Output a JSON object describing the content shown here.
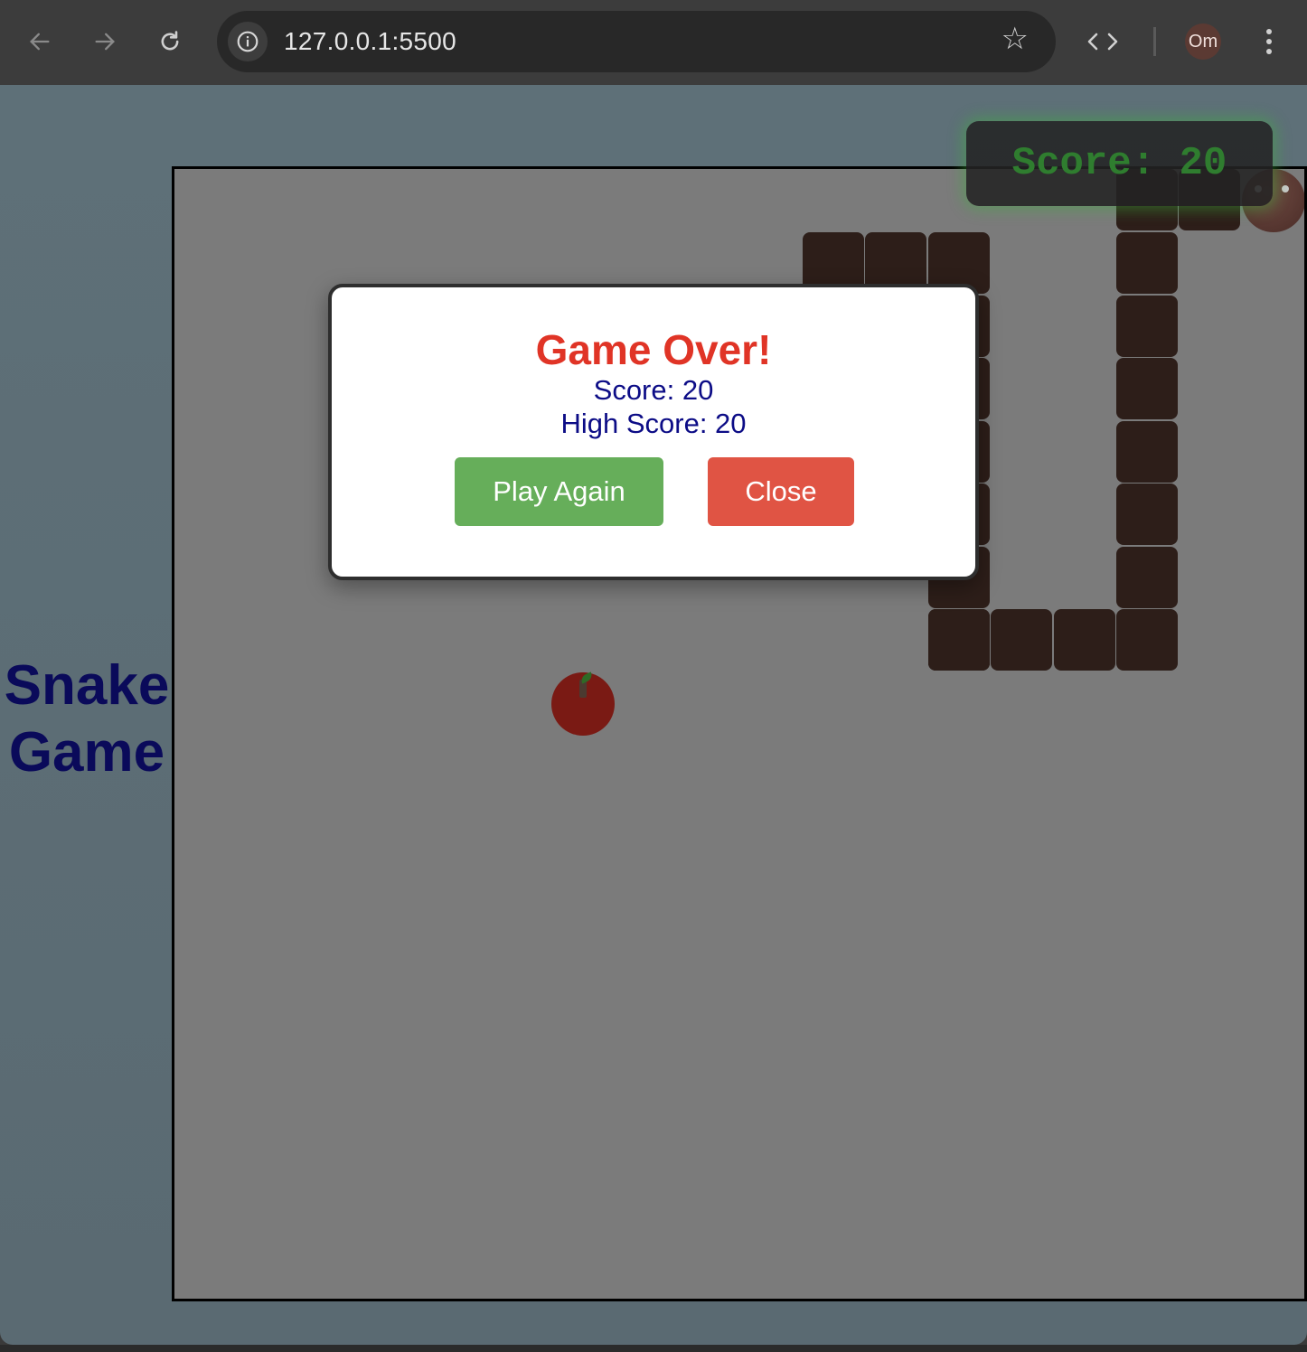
{
  "browser": {
    "url": "127.0.0.1:5500",
    "profile_initials": "Om"
  },
  "page": {
    "side_title_line1": "Snake",
    "side_title_line2": "Game",
    "score_display": "Score: 20"
  },
  "game": {
    "snake_color": "#2d1e19",
    "board_color": "#7b7b7b"
  },
  "modal": {
    "title": "Game Over!",
    "score_text": "Score: 20",
    "high_score_text": "High Score: 20",
    "play_again_label": "Play Again",
    "close_label": "Close"
  },
  "colors": {
    "title_red": "#e03426",
    "text_navy": "#0c0c86",
    "play_green": "#66ae5a",
    "close_red": "#e05444",
    "hud_green": "#2f7d2f"
  }
}
